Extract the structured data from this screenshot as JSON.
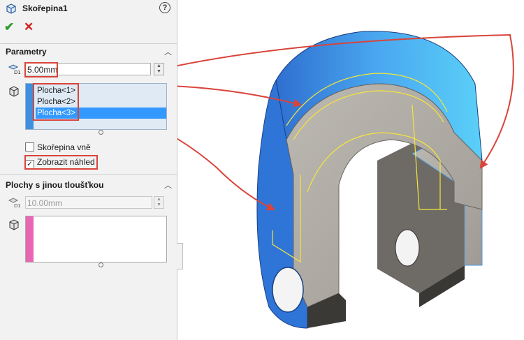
{
  "header": {
    "title": "Skořepina1",
    "help_symbol": "?",
    "ok_symbol": "✔",
    "cancel_symbol": "✕"
  },
  "parametry": {
    "title": "Parametry",
    "thickness_value": "5.00mm",
    "faces": [
      "Plocha<1>",
      "Plocha<2>",
      "Plocha<3>"
    ],
    "selected_face_index": 2,
    "shell_outward_label": "Skořepina vně",
    "shell_outward_checked": false,
    "show_preview_label": "Zobrazit náhled",
    "show_preview_checked": true
  },
  "multi_thickness": {
    "title": "Plochy s jinou tloušťkou",
    "thickness_value": "10.00mm"
  },
  "colors": {
    "accent_blue": "#3399ff",
    "list_bar_blue": "#3d8fe0",
    "list_bar_pink": "#e866b4",
    "annotation_red": "#d9443a",
    "part_gray": "#a8a39c",
    "selected_face_blue": "#3f8fe6"
  },
  "icons": [
    "part-feature-icon",
    "help-icon",
    "ok-checkmark-icon",
    "cancel-x-icon",
    "thickness-icon",
    "face-selection-icon",
    "collapse-chevron-icon"
  ]
}
